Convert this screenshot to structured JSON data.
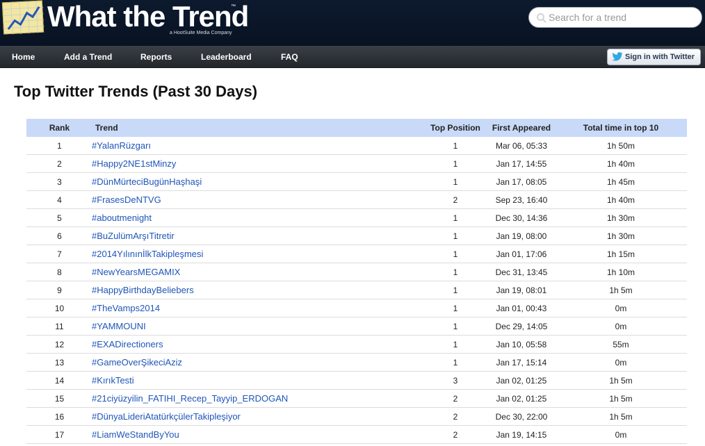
{
  "header": {
    "logo_text": "What the Trend",
    "logo_tm": "™",
    "logo_sub": "a HootSuite Media Company",
    "search_placeholder": "Search for a trend"
  },
  "nav": {
    "items": [
      "Home",
      "Add a Trend",
      "Reports",
      "Leaderboard",
      "FAQ"
    ],
    "twitter_button": "Sign in with Twitter"
  },
  "main": {
    "title": "Top Twitter Trends (Past 30 Days)",
    "table": {
      "headers": {
        "rank": "Rank",
        "trend": "Trend",
        "top_position": "Top Position",
        "first_appeared": "First Appeared",
        "total_time": "Total time in top 10"
      },
      "rows": [
        {
          "rank": "1",
          "trend": "#YalanRüzgarı",
          "top_position": "1",
          "first_appeared": "Mar 06, 05:33",
          "total_time": "1h 50m"
        },
        {
          "rank": "2",
          "trend": "#Happy2NE1stMinzy",
          "top_position": "1",
          "first_appeared": "Jan 17, 14:55",
          "total_time": "1h 40m"
        },
        {
          "rank": "3",
          "trend": "#DünMürteciBugünHaşhaşi",
          "top_position": "1",
          "first_appeared": "Jan 17, 08:05",
          "total_time": "1h 45m"
        },
        {
          "rank": "4",
          "trend": "#FrasesDeNTVG",
          "top_position": "2",
          "first_appeared": "Sep 23, 16:40",
          "total_time": "1h 40m"
        },
        {
          "rank": "5",
          "trend": "#aboutmenight",
          "top_position": "1",
          "first_appeared": "Dec 30, 14:36",
          "total_time": "1h 30m"
        },
        {
          "rank": "6",
          "trend": "#BuZulümArşıTitretir",
          "top_position": "1",
          "first_appeared": "Jan 19, 08:00",
          "total_time": "1h 30m"
        },
        {
          "rank": "7",
          "trend": "#2014YılınınİlkTakipleşmesi",
          "top_position": "1",
          "first_appeared": "Jan 01, 17:06",
          "total_time": "1h 15m"
        },
        {
          "rank": "8",
          "trend": "#NewYearsMEGAMIX",
          "top_position": "1",
          "first_appeared": "Dec 31, 13:45",
          "total_time": "1h 10m"
        },
        {
          "rank": "9",
          "trend": "#HappyBirthdayBeliebers",
          "top_position": "1",
          "first_appeared": "Jan 19, 08:01",
          "total_time": "1h 5m"
        },
        {
          "rank": "10",
          "trend": "#TheVamps2014",
          "top_position": "1",
          "first_appeared": "Jan 01, 00:43",
          "total_time": "0m"
        },
        {
          "rank": "11",
          "trend": "#YAMMOUNI",
          "top_position": "1",
          "first_appeared": "Dec 29, 14:05",
          "total_time": "0m"
        },
        {
          "rank": "12",
          "trend": "#EXADirectioners",
          "top_position": "1",
          "first_appeared": "Jan 10, 05:58",
          "total_time": "55m"
        },
        {
          "rank": "13",
          "trend": "#GameOverŞikeciAziz",
          "top_position": "1",
          "first_appeared": "Jan 17, 15:14",
          "total_time": "0m"
        },
        {
          "rank": "14",
          "trend": "#KırıkTesti",
          "top_position": "3",
          "first_appeared": "Jan 02, 01:25",
          "total_time": "1h 5m"
        },
        {
          "rank": "15",
          "trend": "#21ciyüzyilin_FATIHI_Recep_Tayyip_ERDOGAN",
          "top_position": "2",
          "first_appeared": "Jan 02, 01:25",
          "total_time": "1h 5m"
        },
        {
          "rank": "16",
          "trend": "#DünyaLideriAtatürkçülerTakipleşiyor",
          "top_position": "2",
          "first_appeared": "Dec 30, 22:00",
          "total_time": "1h 5m"
        },
        {
          "rank": "17",
          "trend": "#LiamWeStandByYou",
          "top_position": "2",
          "first_appeared": "Jan 19, 14:15",
          "total_time": "0m"
        }
      ]
    }
  },
  "icons": {
    "logo": "trend-chart-icon",
    "search": "search-icon",
    "twitter": "twitter-bird-icon"
  },
  "colors": {
    "header_bg": "#0d1a2e",
    "nav_bg": "#2c3035",
    "table_header_bg": "#c8daf8",
    "link": "#1f55b8"
  }
}
